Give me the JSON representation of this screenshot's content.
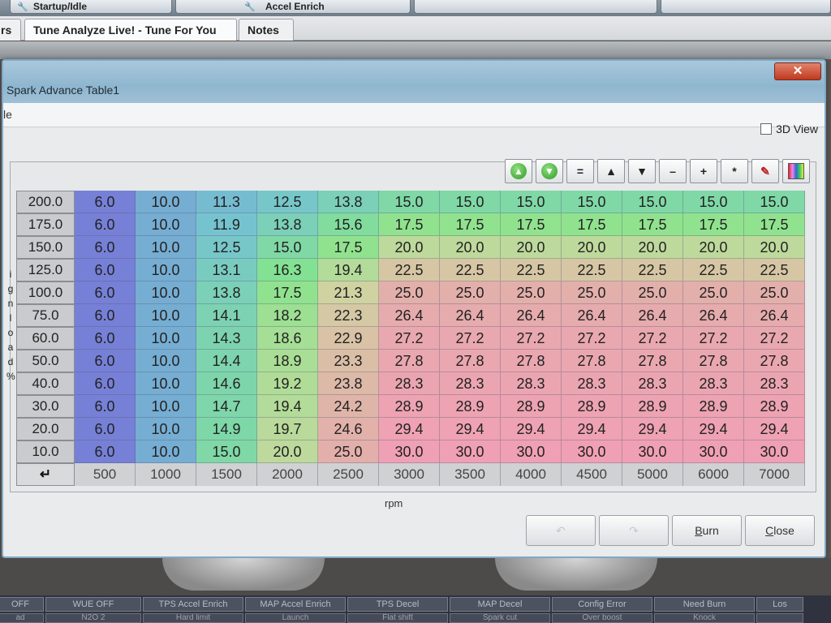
{
  "app": {
    "top_buttons": [
      {
        "label": "Startup/Idle",
        "icon": "wrench-icon"
      },
      {
        "label": "Accel Enrich",
        "icon": "wrench-icon"
      }
    ],
    "tabs": [
      {
        "label": "rs"
      },
      {
        "label": "Tune Analyze Live! - Tune For You"
      },
      {
        "label": "Notes"
      }
    ]
  },
  "dialog": {
    "title": "Spark Advance Table1",
    "menu_text": "le",
    "close_glyph": "✕",
    "view3d_label": "3D View",
    "toolbar": [
      {
        "name": "increase-round-button",
        "glyph": "▲",
        "icon": "green-up-arrow-icon"
      },
      {
        "name": "decrease-round-button",
        "glyph": "▼",
        "icon": "green-down-arrow-icon"
      },
      {
        "name": "set-equal-button",
        "glyph": "="
      },
      {
        "name": "increment-button",
        "glyph": "▲"
      },
      {
        "name": "decrement-button",
        "glyph": "▼"
      },
      {
        "name": "subtract-button",
        "glyph": "–"
      },
      {
        "name": "add-button",
        "glyph": "+"
      },
      {
        "name": "multiply-button",
        "glyph": "*"
      },
      {
        "name": "pen-button",
        "glyph": "✎",
        "icon": "pen-icon"
      },
      {
        "name": "color-button",
        "glyph": "",
        "icon": "color-palette-icon"
      }
    ],
    "y_axis_title_chars": [
      "i",
      "g",
      "n",
      "l",
      "o",
      "a",
      "d",
      "",
      "%"
    ],
    "x_axis_title": "rpm",
    "corner_glyph": "↵",
    "buttons": [
      {
        "name": "undo-button",
        "label": "↶",
        "enabled": false
      },
      {
        "name": "redo-button",
        "label": "↷",
        "enabled": false
      },
      {
        "name": "burn-button",
        "label": "Burn",
        "enabled": true
      },
      {
        "name": "close-button",
        "label": "Close",
        "enabled": true
      }
    ]
  },
  "chart_data": {
    "type": "table",
    "title": "Spark Advance Table1",
    "xlabel": "rpm",
    "ylabel": "ignload %",
    "x": [
      "500",
      "1000",
      "1500",
      "2000",
      "2500",
      "3000",
      "3500",
      "4000",
      "4500",
      "5000",
      "6000",
      "7000"
    ],
    "y": [
      "200.0",
      "175.0",
      "150.0",
      "125.0",
      "100.0",
      "75.0",
      "60.0",
      "50.0",
      "40.0",
      "30.0",
      "20.0",
      "10.0"
    ],
    "values": [
      [
        "6.0",
        "10.0",
        "11.3",
        "12.5",
        "13.8",
        "15.0",
        "15.0",
        "15.0",
        "15.0",
        "15.0",
        "15.0",
        "15.0"
      ],
      [
        "6.0",
        "10.0",
        "11.9",
        "13.8",
        "15.6",
        "17.5",
        "17.5",
        "17.5",
        "17.5",
        "17.5",
        "17.5",
        "17.5"
      ],
      [
        "6.0",
        "10.0",
        "12.5",
        "15.0",
        "17.5",
        "20.0",
        "20.0",
        "20.0",
        "20.0",
        "20.0",
        "20.0",
        "20.0"
      ],
      [
        "6.0",
        "10.0",
        "13.1",
        "16.3",
        "19.4",
        "22.5",
        "22.5",
        "22.5",
        "22.5",
        "22.5",
        "22.5",
        "22.5"
      ],
      [
        "6.0",
        "10.0",
        "13.8",
        "17.5",
        "21.3",
        "25.0",
        "25.0",
        "25.0",
        "25.0",
        "25.0",
        "25.0",
        "25.0"
      ],
      [
        "6.0",
        "10.0",
        "14.1",
        "18.2",
        "22.3",
        "26.4",
        "26.4",
        "26.4",
        "26.4",
        "26.4",
        "26.4",
        "26.4"
      ],
      [
        "6.0",
        "10.0",
        "14.3",
        "18.6",
        "22.9",
        "27.2",
        "27.2",
        "27.2",
        "27.2",
        "27.2",
        "27.2",
        "27.2"
      ],
      [
        "6.0",
        "10.0",
        "14.4",
        "18.9",
        "23.3",
        "27.8",
        "27.8",
        "27.8",
        "27.8",
        "27.8",
        "27.8",
        "27.8"
      ],
      [
        "6.0",
        "10.0",
        "14.6",
        "19.2",
        "23.8",
        "28.3",
        "28.3",
        "28.3",
        "28.3",
        "28.3",
        "28.3",
        "28.3"
      ],
      [
        "6.0",
        "10.0",
        "14.7",
        "19.4",
        "24.2",
        "28.9",
        "28.9",
        "28.9",
        "28.9",
        "28.9",
        "28.9",
        "28.9"
      ],
      [
        "6.0",
        "10.0",
        "14.9",
        "19.7",
        "24.6",
        "29.4",
        "29.4",
        "29.4",
        "29.4",
        "29.4",
        "29.4",
        "29.4"
      ],
      [
        "6.0",
        "10.0",
        "15.0",
        "20.0",
        "25.0",
        "30.0",
        "30.0",
        "30.0",
        "30.0",
        "30.0",
        "30.0",
        "30.0"
      ]
    ]
  },
  "status_bar": {
    "top": [
      "OFF",
      "WUE OFF",
      "TPS Accel Enrich",
      "MAP Accel Enrich",
      "TPS Decel",
      "MAP Decel",
      "Config Error",
      "Need Burn",
      "Los"
    ],
    "bottom": [
      "ad",
      "N2O 2",
      "Hard limit",
      "Launch",
      "Flat shift",
      "Spark cut",
      "Over boost",
      "Knock",
      ""
    ]
  }
}
